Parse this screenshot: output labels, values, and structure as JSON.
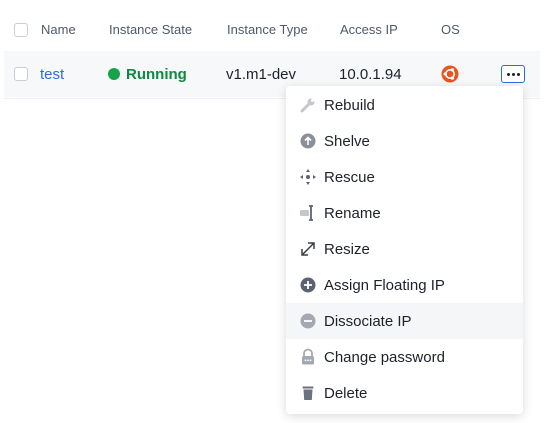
{
  "table": {
    "columns": [
      "Name",
      "Instance State",
      "Instance Type",
      "Access IP",
      "OS"
    ],
    "row": {
      "name": "test",
      "state": "Running",
      "type": "v1.m1-dev",
      "ip": "10.0.1.94",
      "os_icon": "ubuntu-icon"
    }
  },
  "menu": {
    "items": [
      {
        "label": "Rebuild",
        "icon": "wrench-icon"
      },
      {
        "label": "Shelve",
        "icon": "shelve-icon"
      },
      {
        "label": "Rescue",
        "icon": "rescue-icon"
      },
      {
        "label": "Rename",
        "icon": "rename-icon"
      },
      {
        "label": "Resize",
        "icon": "resize-icon"
      },
      {
        "label": "Assign Floating IP",
        "icon": "plus-icon"
      },
      {
        "label": "Dissociate IP",
        "icon": "minus-icon"
      },
      {
        "label": "Change password",
        "icon": "lock-icon"
      },
      {
        "label": "Delete",
        "icon": "trash-icon"
      }
    ]
  },
  "colors": {
    "link": "#2f6bde",
    "running": "#16a34a",
    "ubuntu": "#e95420",
    "menu_icon": "#8a8f99"
  }
}
